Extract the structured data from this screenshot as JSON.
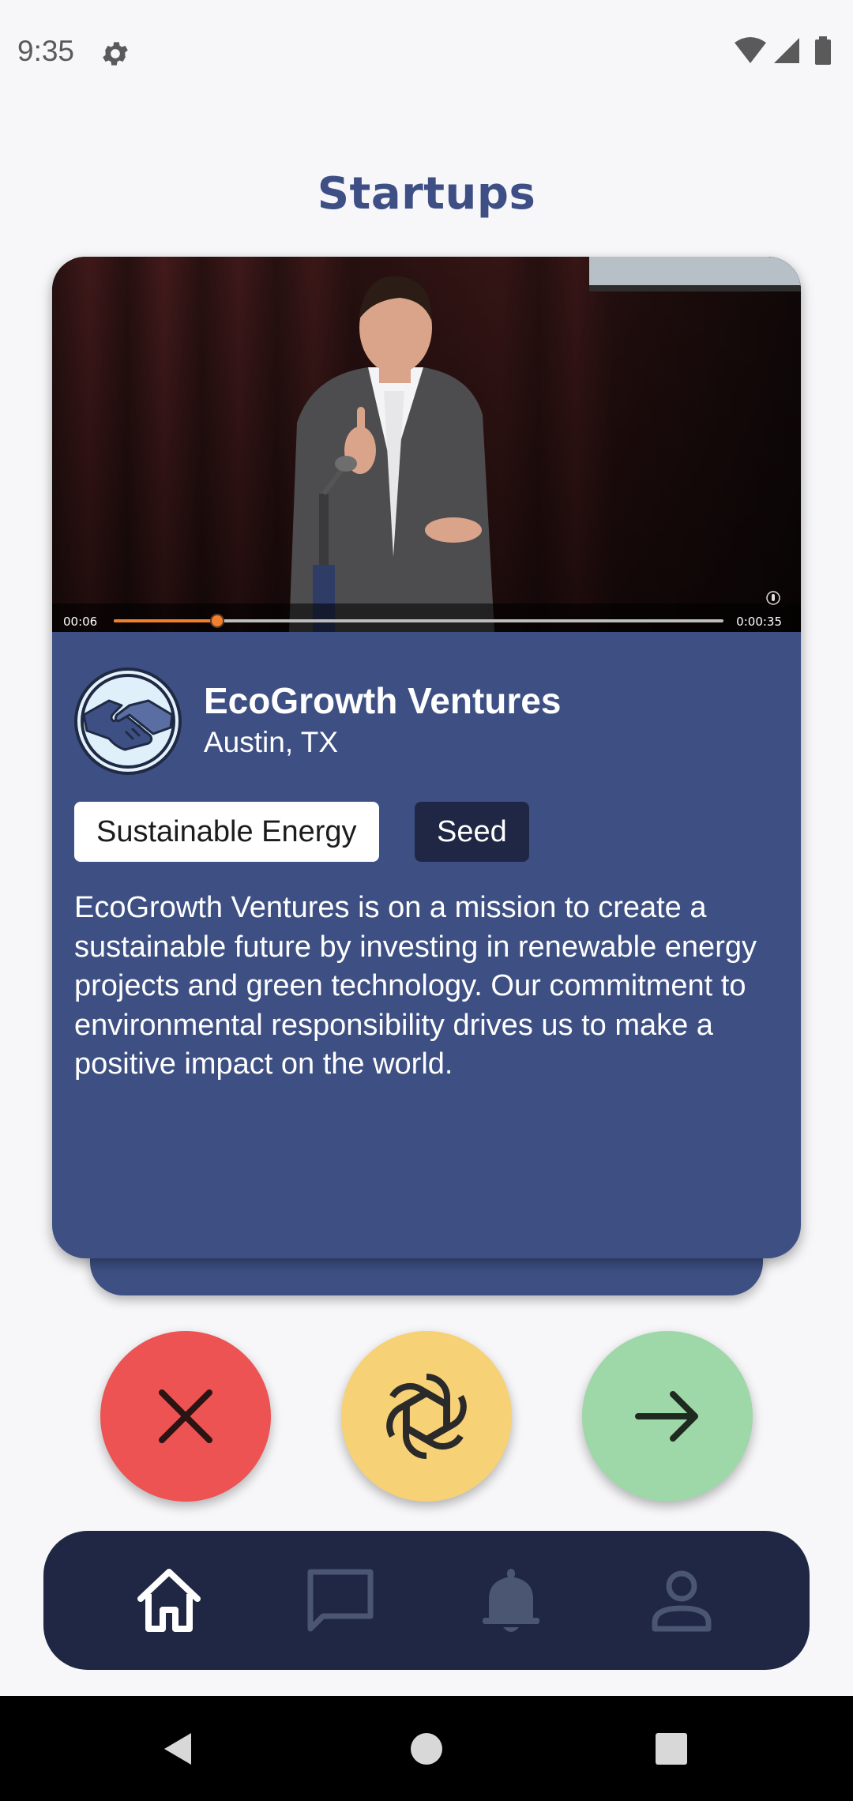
{
  "status_bar": {
    "time": "9:35"
  },
  "header": {
    "title": "Startups"
  },
  "video": {
    "current_time": "00:06",
    "duration": "0:00:35",
    "progress_fraction": 0.17
  },
  "startup": {
    "name": "EcoGrowth Ventures",
    "location": "Austin, TX",
    "tags": {
      "sector": "Sustainable Energy",
      "stage": "Seed"
    },
    "description": "EcoGrowth Ventures is on a mission to create a sustainable future by investing in renewable energy projects and green technology. Our commitment to environmental responsibility drives us to make a positive impact on the world."
  },
  "actions": {
    "reject_icon": "close-icon",
    "ai_icon": "openai-icon",
    "next_icon": "arrow-right-icon"
  },
  "bottom_nav": {
    "items": [
      "home-icon",
      "chat-icon",
      "bell-icon",
      "profile-icon"
    ],
    "active": "home-icon"
  },
  "colors": {
    "card": "#3e5083",
    "nav": "#1f2744",
    "reject": "#ec5352",
    "ai": "#f7d175",
    "next": "#9ed8a9",
    "accent": "#f07f2e"
  }
}
